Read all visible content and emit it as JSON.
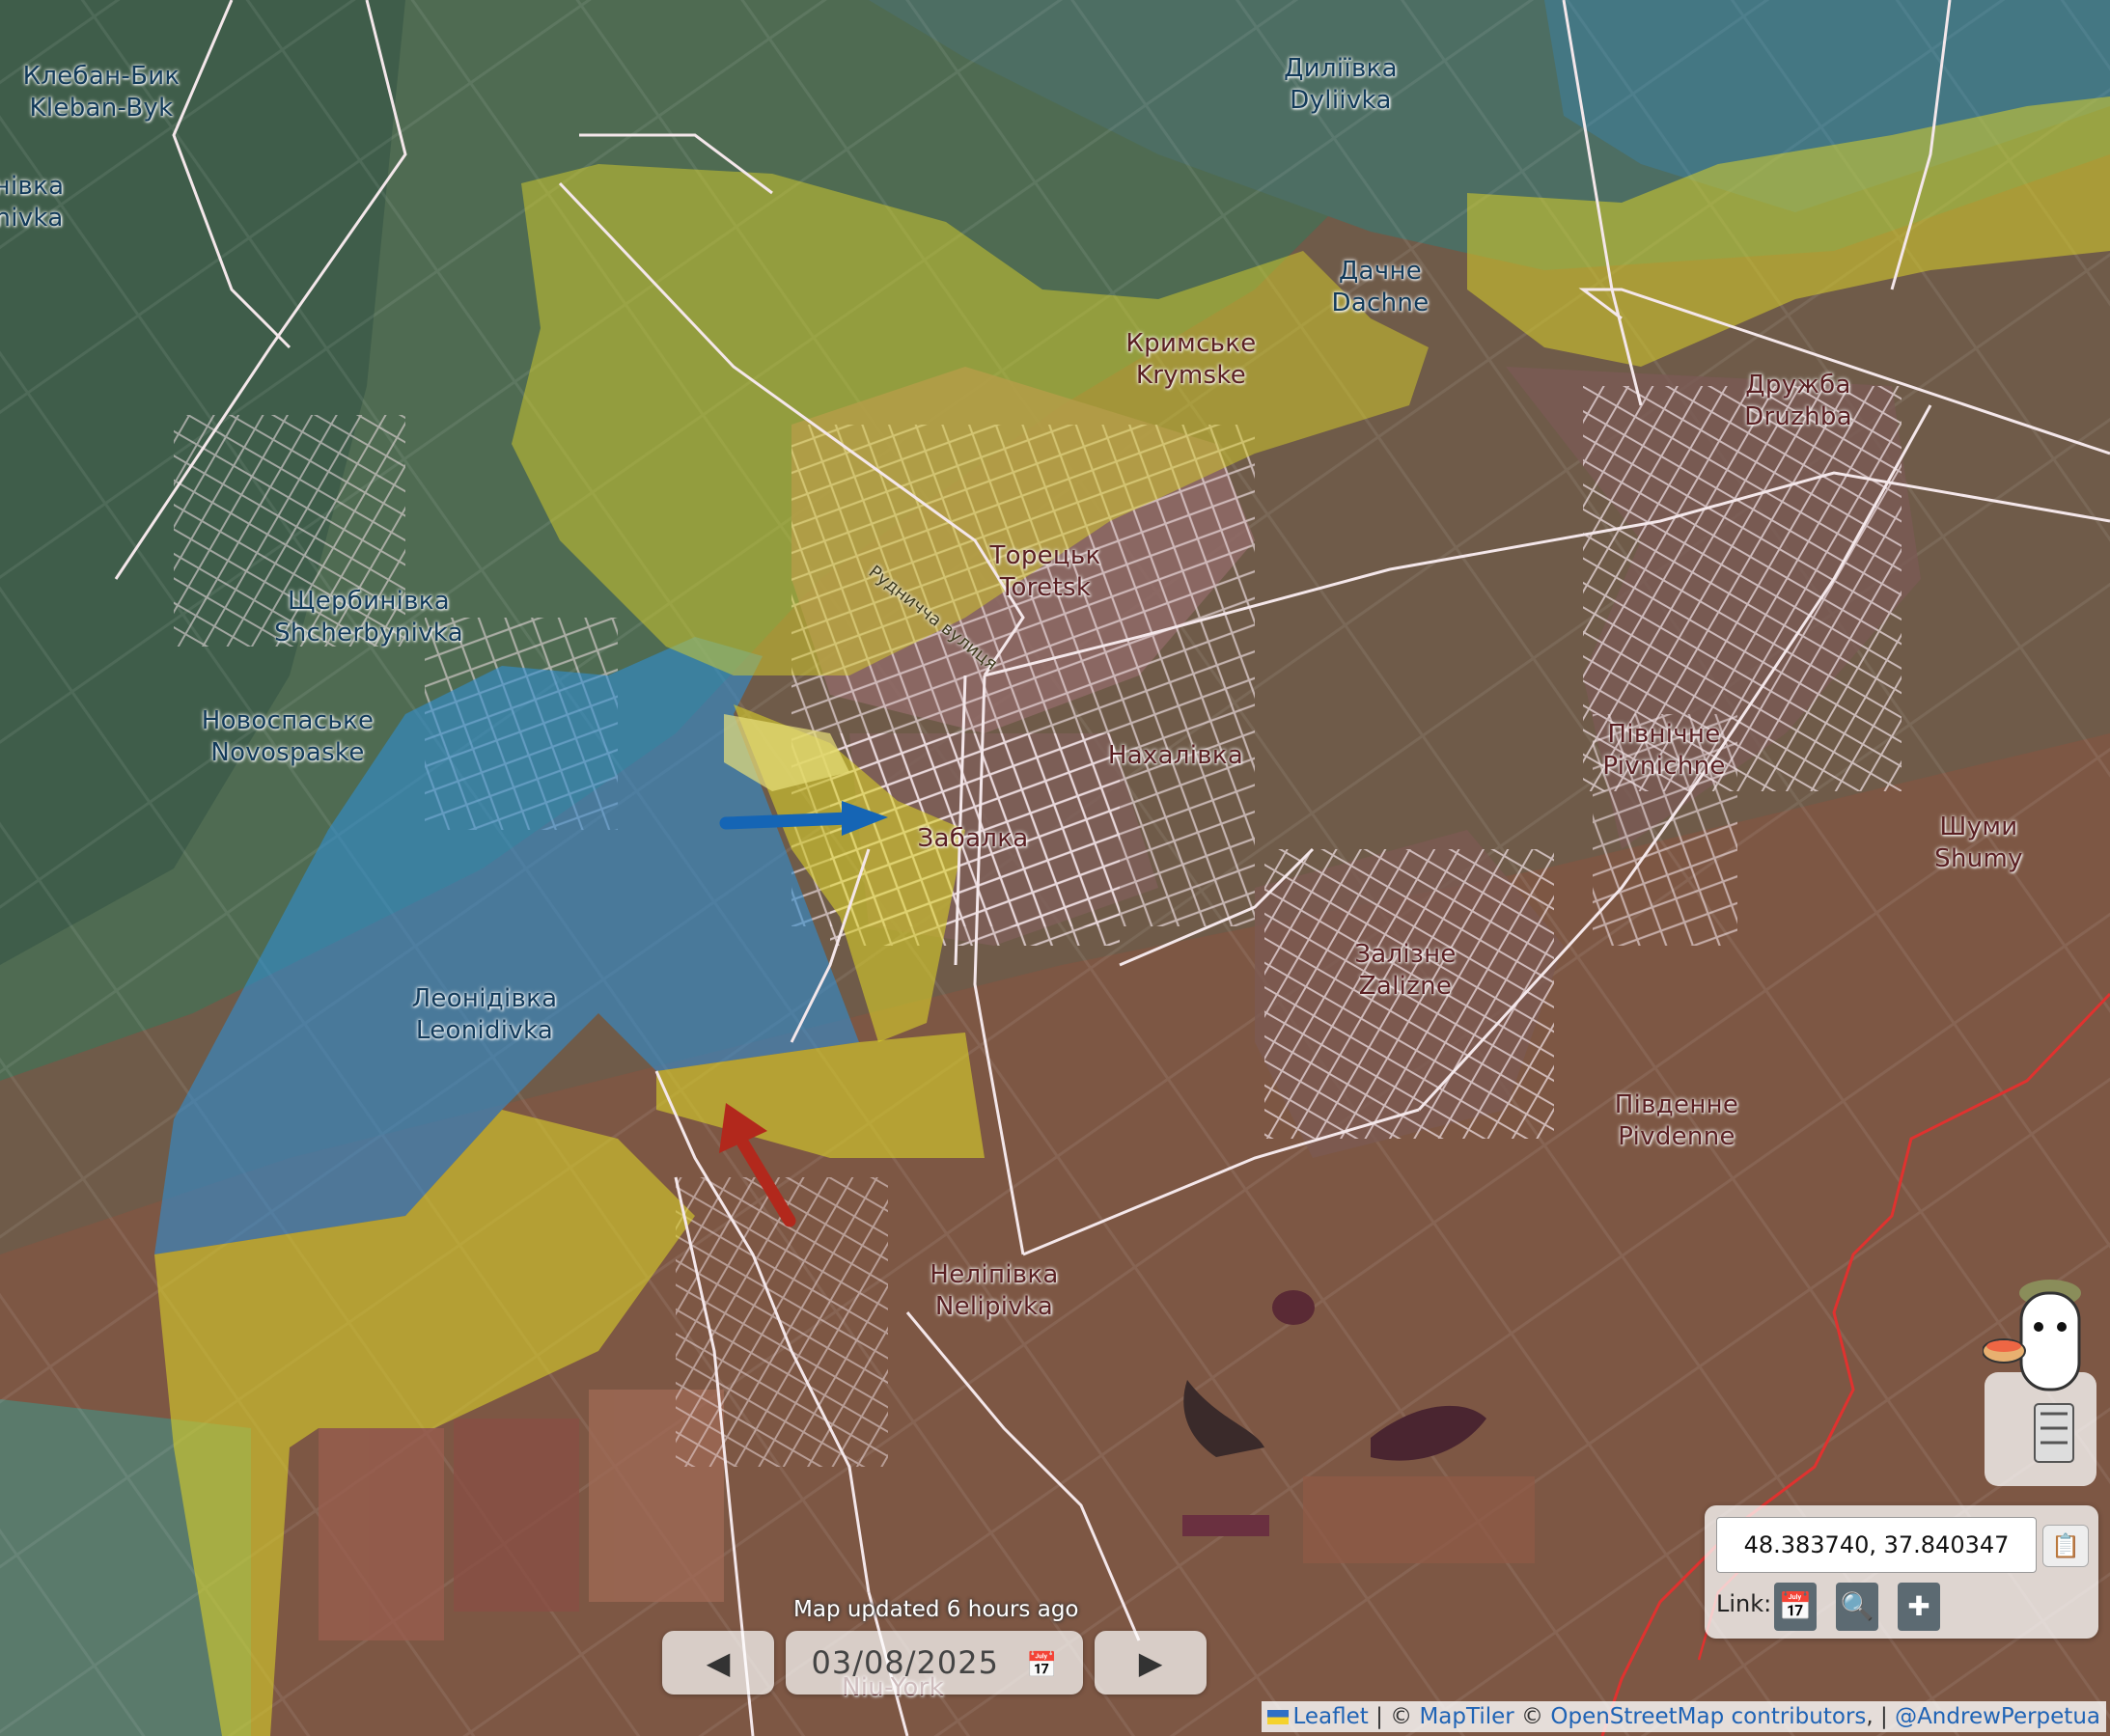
{
  "places": [
    {
      "id": "klebanbyk",
      "uk": "Клебан-Бик",
      "en": "Kleban-Byk",
      "tone": "dark"
    },
    {
      "id": "nivka",
      "uk": "нівка",
      "en": "nivka",
      "tone": "dark"
    },
    {
      "id": "dyliivka",
      "uk": "Диліївка",
      "en": "Dyliivka",
      "tone": "dark"
    },
    {
      "id": "dachne",
      "uk": "Дачне",
      "en": "Dachne",
      "tone": "dark"
    },
    {
      "id": "krymske",
      "uk": "Кримське",
      "en": "Krymske",
      "tone": "red"
    },
    {
      "id": "druzhba",
      "uk": "Дружба",
      "en": "Druzhba",
      "tone": "red"
    },
    {
      "id": "toretsk",
      "uk": "Торецьк",
      "en": "Toretsk",
      "tone": "red"
    },
    {
      "id": "shcherbynivka",
      "uk": "Щербинівка",
      "en": "Shcherbynivka",
      "tone": "dark"
    },
    {
      "id": "novospaske",
      "uk": "Новоспаське",
      "en": "Novospaske",
      "tone": "dark"
    },
    {
      "id": "nakhalivka",
      "uk": "Нахалівка",
      "en": "",
      "tone": "red"
    },
    {
      "id": "pivnichne",
      "uk": "Північне",
      "en": "Pivnichne",
      "tone": "red"
    },
    {
      "id": "shumy",
      "uk": "Шуми",
      "en": "Shumy",
      "tone": "red"
    },
    {
      "id": "zabalka",
      "uk": "Забалка",
      "en": "",
      "tone": "red"
    },
    {
      "id": "leonidivka",
      "uk": "Леонідівка",
      "en": "Leonidivka",
      "tone": "dark"
    },
    {
      "id": "zalizne",
      "uk": "Залізне",
      "en": "Zalizne",
      "tone": "red"
    },
    {
      "id": "pivdenne",
      "uk": "Південне",
      "en": "Pivdenne",
      "tone": "red"
    },
    {
      "id": "nelipivka",
      "uk": "Неліпівка",
      "en": "Nelipivka",
      "tone": "red"
    },
    {
      "id": "niuyork",
      "uk": "",
      "en": "Niu-York",
      "tone": "red"
    }
  ],
  "street_label": "Рудничча вулиця",
  "arrows": [
    {
      "side": "ukraine",
      "color": "#1565b5"
    },
    {
      "side": "russia",
      "color": "#b2281c"
    }
  ],
  "colors": {
    "ukraine_control": "#2f8fd6",
    "contested": "#d8cf2a",
    "frontline": "#e0322f",
    "roads": "#f4e7ea"
  },
  "coordinates": {
    "value": "48.383740, 37.840347",
    "copy_icon": "clipboard-icon",
    "link_label": "Link:",
    "link_icons": [
      "calendar-icon",
      "magnifier-icon",
      "crosshair-icon"
    ]
  },
  "timebar": {
    "updated": "Map updated 6 hours ago",
    "prev": "◀",
    "date": "03/08/2025",
    "next": "▶",
    "calendar_icon": "calendar-icon"
  },
  "mascot_icon": "mascot-icon",
  "attribution": {
    "leaflet": "Leaflet",
    "sep1": " | © ",
    "maptiler": "MapTiler",
    "sep2": " © ",
    "osm": "OpenStreetMap contributors",
    "sep3": ", | ",
    "author": "@AndrewPerpetua"
  }
}
